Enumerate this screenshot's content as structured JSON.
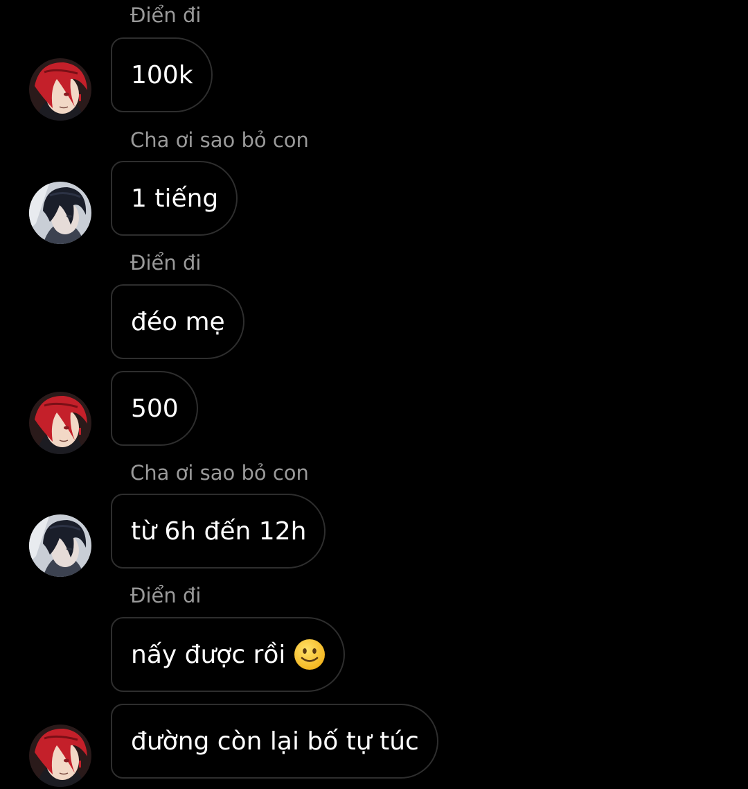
{
  "chat": {
    "senders": {
      "a": "Điển đi",
      "b": "Cha ơi sao bỏ con"
    },
    "messages": [
      {
        "sender": "Điển đi",
        "text": "100k",
        "avatar": "red-hair-avatar"
      },
      {
        "sender": "Cha ơi sao bỏ con",
        "text": "1 tiếng",
        "avatar": "dark-hair-avatar"
      },
      {
        "sender": "Điển đi",
        "text": "đéo mẹ",
        "avatar": ""
      },
      {
        "sender": "",
        "text": "500",
        "avatar": "red-hair-avatar"
      },
      {
        "sender": "Cha ơi sao bỏ con",
        "text": "từ 6h đến 12h",
        "avatar": "dark-hair-avatar"
      },
      {
        "sender": "Điển đi",
        "text": "nấy được rồi",
        "emoji": "slightly-smiling-face",
        "avatar": ""
      },
      {
        "sender": "",
        "text": "đường còn lại bố tự túc",
        "avatar": "red-hair-avatar"
      }
    ]
  },
  "colors": {
    "background": "#000000",
    "bubble_border": "#2e2e2e",
    "sender_text": "#9a9a9a",
    "message_text": "#ffffff"
  }
}
